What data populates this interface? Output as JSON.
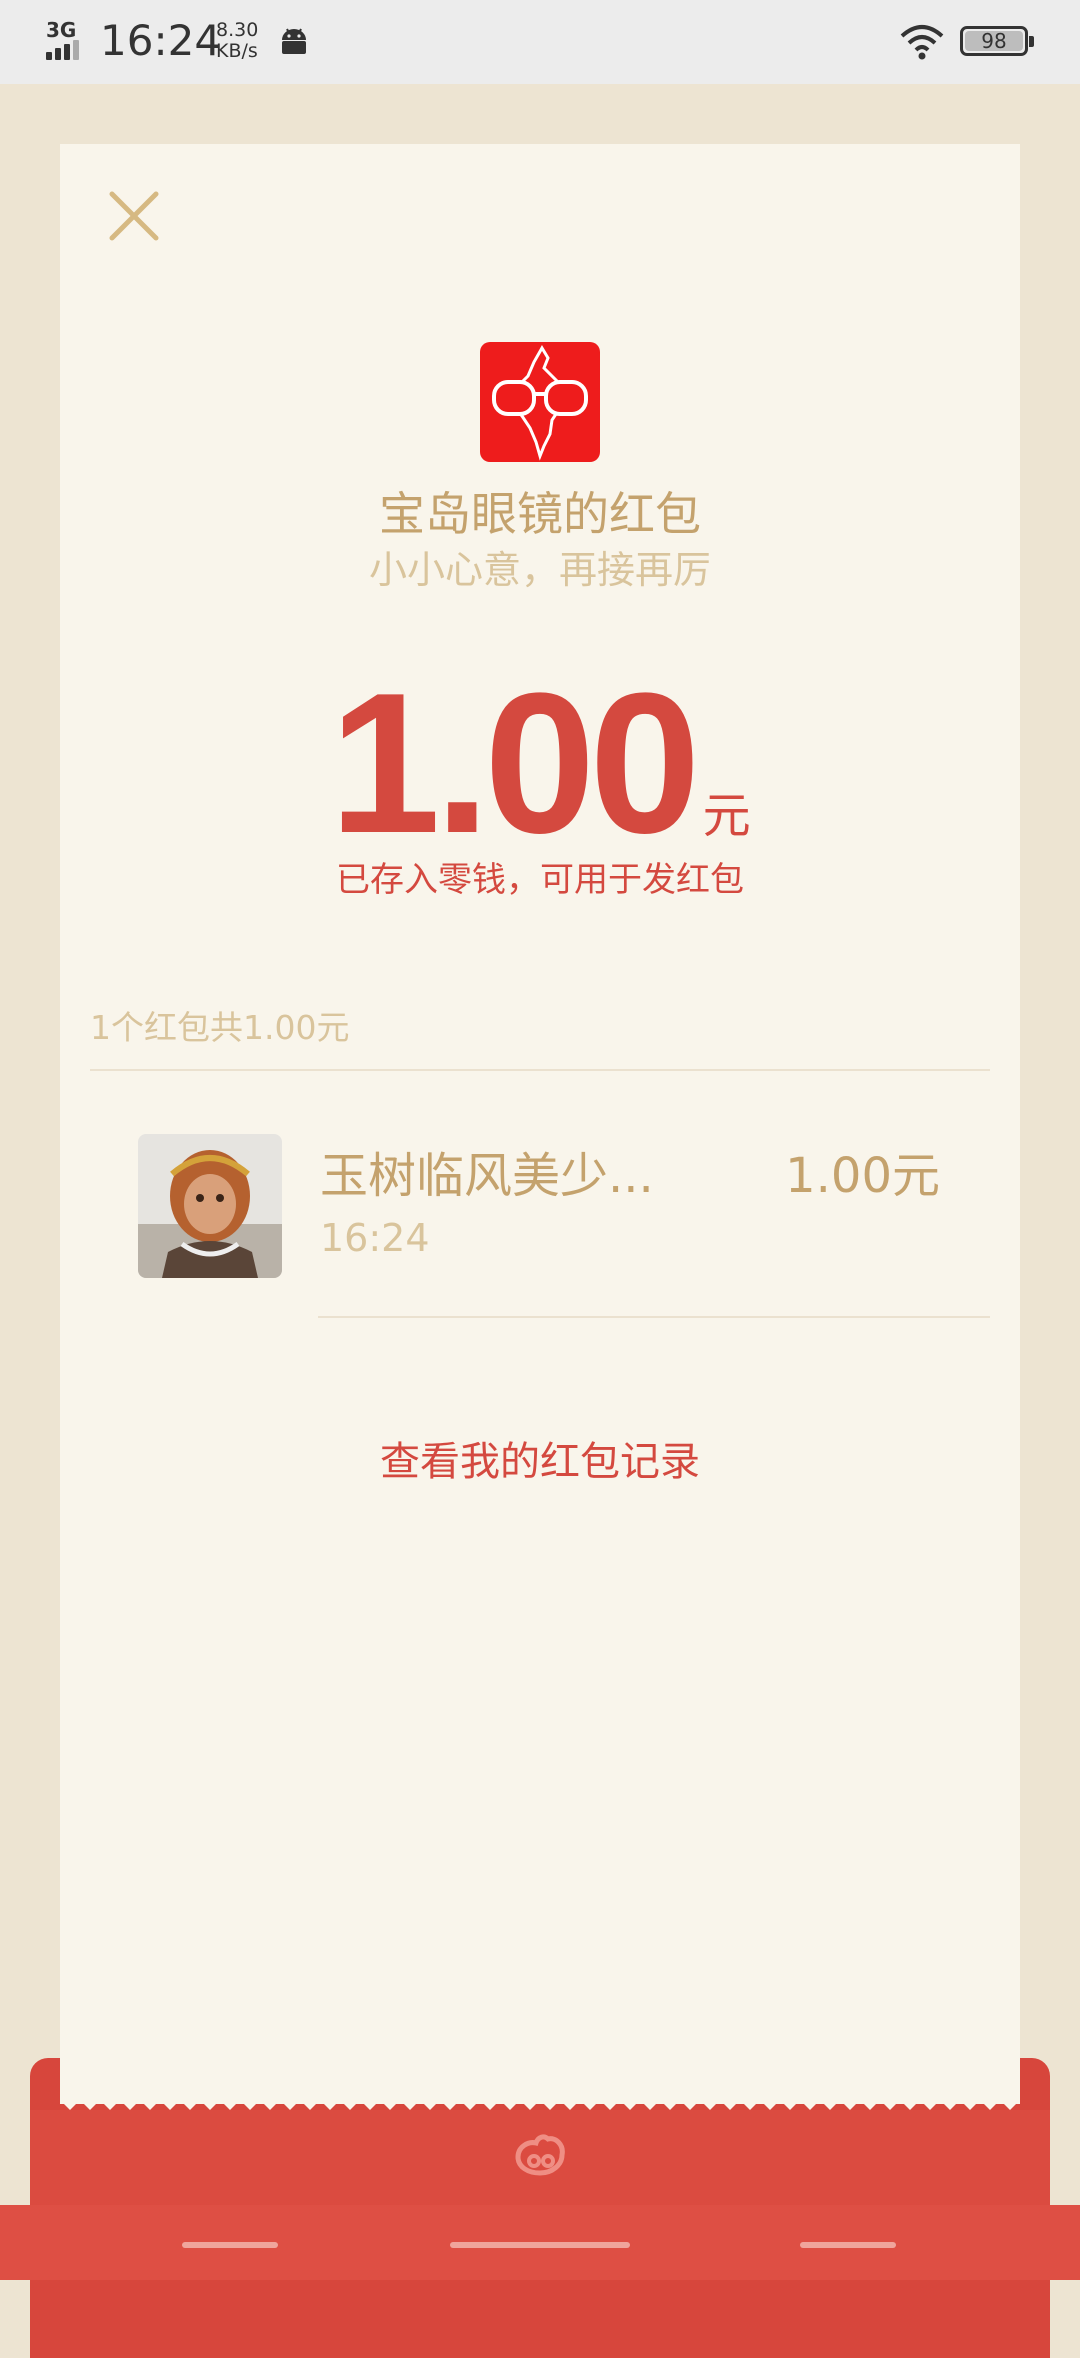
{
  "status_bar": {
    "network": "3G",
    "time": "16:24",
    "speed_value": "8.30",
    "speed_unit": "KB/s",
    "battery": "98"
  },
  "packet": {
    "sender_title": "宝岛眼镜的红包",
    "wish": "小小心意，再接再厉",
    "amount": "1.00",
    "amount_unit": "元",
    "deposit_note": "已存入零钱，可用于发红包",
    "summary": "1个红包共1.00元"
  },
  "records": [
    {
      "name": "玉树临风美少...",
      "time": "16:24",
      "amount": "1.00元"
    }
  ],
  "history_link": "查看我的红包记录",
  "colors": {
    "accent_red": "#d4493f",
    "gold": "#c4a26d",
    "light_gold": "#d9c49c",
    "card_bg": "#f9f5eb",
    "page_bg": "#ede4d2"
  }
}
